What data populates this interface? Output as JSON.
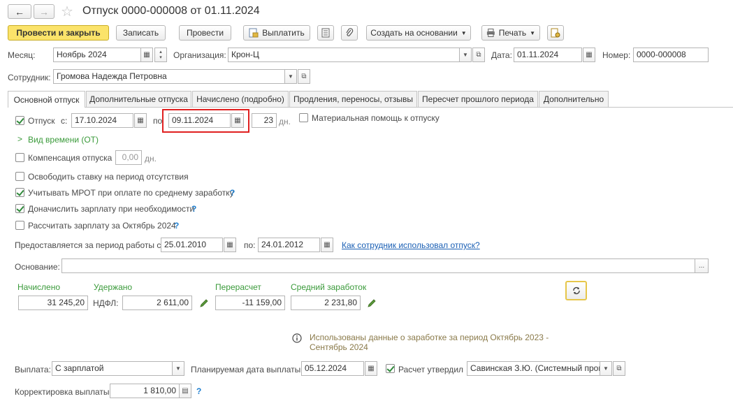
{
  "window": {
    "title": "Отпуск 0000-000008 от 01.11.2024",
    "back": "←",
    "forward": "→",
    "star": "☆"
  },
  "toolbar": {
    "post_close": "Провести и закрыть",
    "save": "Записать",
    "post": "Провести",
    "pay": "Выплатить",
    "create_based": "Создать на основании",
    "print": "Печать"
  },
  "header": {
    "month_label": "Месяц:",
    "month_value": "Ноябрь 2024",
    "org_label": "Организация:",
    "org_value": "Крон-Ц",
    "date_label": "Дата:",
    "date_value": "01.11.2024",
    "number_label": "Номер:",
    "number_value": "0000-000008",
    "employee_label": "Сотрудник:",
    "employee_value": "Громова Надежда Петровна"
  },
  "tabs": [
    "Основной отпуск",
    "Дополнительные отпуска",
    "Начислено (подробно)",
    "Продления, переносы, отзывы",
    "Пересчет прошлого периода",
    "Дополнительно"
  ],
  "main": {
    "vacation_label": "Отпуск",
    "from_label": "с:",
    "from_value": "17.10.2024",
    "to_label": "по",
    "to_value": "09.11.2024",
    "days_value": "23",
    "days_unit": "дн.",
    "material_help": "Материальная помощь к отпуску",
    "time_type": "Вид времени (ОТ)",
    "compensation_label": "Компенсация отпуска",
    "compensation_value": "0,00",
    "compensation_unit": "дн.",
    "release_rate": "Освободить ставку на период отсутствия",
    "mrot": "Учитывать МРОТ при оплате по среднему заработку",
    "accrue": "Доначислить зарплату при необходимости",
    "calc_salary": "Рассчитать зарплату за Октябрь 2024",
    "q": "?",
    "period_label": "Предоставляется за период работы с:",
    "period_from": "25.01.2010",
    "period_to_label": "по:",
    "period_to": "24.01.2012",
    "how_used_link": "Как сотрудник использовал отпуск?",
    "basis_label": "Основание:",
    "basis_value": "",
    "basis_more": "...",
    "accrued_label": "Начислено",
    "accrued_value": "31 245,20",
    "withheld_label": "Удержано",
    "ndfl_label": "НДФЛ:",
    "ndfl_value": "2 611,00",
    "recalc_label": "Перерасчет",
    "recalc_value": "-11 159,00",
    "avg_label": "Средний заработок",
    "avg_value": "2 231,80",
    "info_text_1": "Использованы данные о заработке за период Октябрь 2023 -",
    "info_text_2": "Сентябрь 2024",
    "payout_label": "Выплата:",
    "payout_value": "С зарплатой",
    "planned_date_label": "Планируемая дата выплаты:",
    "planned_date_value": "05.12.2024",
    "approved_label": "Расчет утвердил",
    "approved_value": "Савинская З.Ю. (Системный прог",
    "adjust_label": "Корректировка выплаты:",
    "adjust_value": "1 810,00"
  }
}
